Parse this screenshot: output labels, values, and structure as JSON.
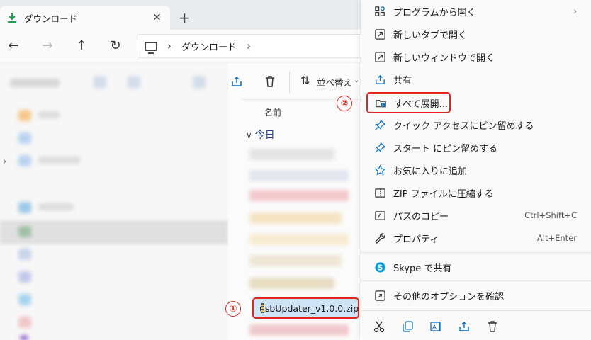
{
  "tab": {
    "title": "ダウンロード",
    "close": "×",
    "new": "+"
  },
  "nav": {
    "back": "←",
    "forward": "→",
    "up": "↑",
    "refresh": "↻"
  },
  "address": {
    "separator": "›",
    "crumbs": [
      "ダウンロード"
    ],
    "trailing": "›"
  },
  "toolbar": {
    "sort_label": "並べ替え",
    "sort_chevron": "⌄"
  },
  "list": {
    "column_name": "名前",
    "group": "今日",
    "group_chevron": "∨",
    "selected_file": "usbUpdater_v1.0.0.zip"
  },
  "markers": {
    "step1": "①",
    "step2": "②"
  },
  "context_menu": {
    "items": [
      {
        "icon": "open-with-icon",
        "label": "プログラムから開く",
        "submenu": "›"
      },
      {
        "icon": "new-tab-icon",
        "label": "新しいタブで開く"
      },
      {
        "icon": "new-window-icon",
        "label": "新しいウィンドウで開く"
      },
      {
        "icon": "share-icon",
        "label": "共有"
      },
      {
        "icon": "extract-icon",
        "label": "すべて展開..."
      },
      {
        "icon": "pin-icon",
        "label": "クイック アクセスにピン留めする"
      },
      {
        "icon": "pin-start-icon",
        "label": "スタート にピン留めする"
      },
      {
        "icon": "star-icon",
        "label": "お気に入りに追加"
      },
      {
        "icon": "zip-icon",
        "label": "ZIP ファイルに圧縮する"
      },
      {
        "icon": "copy-path-icon",
        "label": "パスのコピー",
        "shortcut": "Ctrl+Shift+C"
      },
      {
        "icon": "properties-icon",
        "label": "プロパティ",
        "shortcut": "Alt+Enter"
      },
      {
        "icon": "skype-icon",
        "label": "Skype で共有"
      },
      {
        "icon": "more-options-icon",
        "label": "その他のオプションを確認"
      }
    ],
    "bottom_actions": [
      "cut-icon",
      "copy-icon",
      "rename-icon",
      "share-icon",
      "delete-icon"
    ]
  },
  "colors": {
    "highlight": "#e1251b",
    "accent": "#0f6cbd",
    "selection": "#cfe3f7",
    "download_green": "#1e9e57"
  }
}
